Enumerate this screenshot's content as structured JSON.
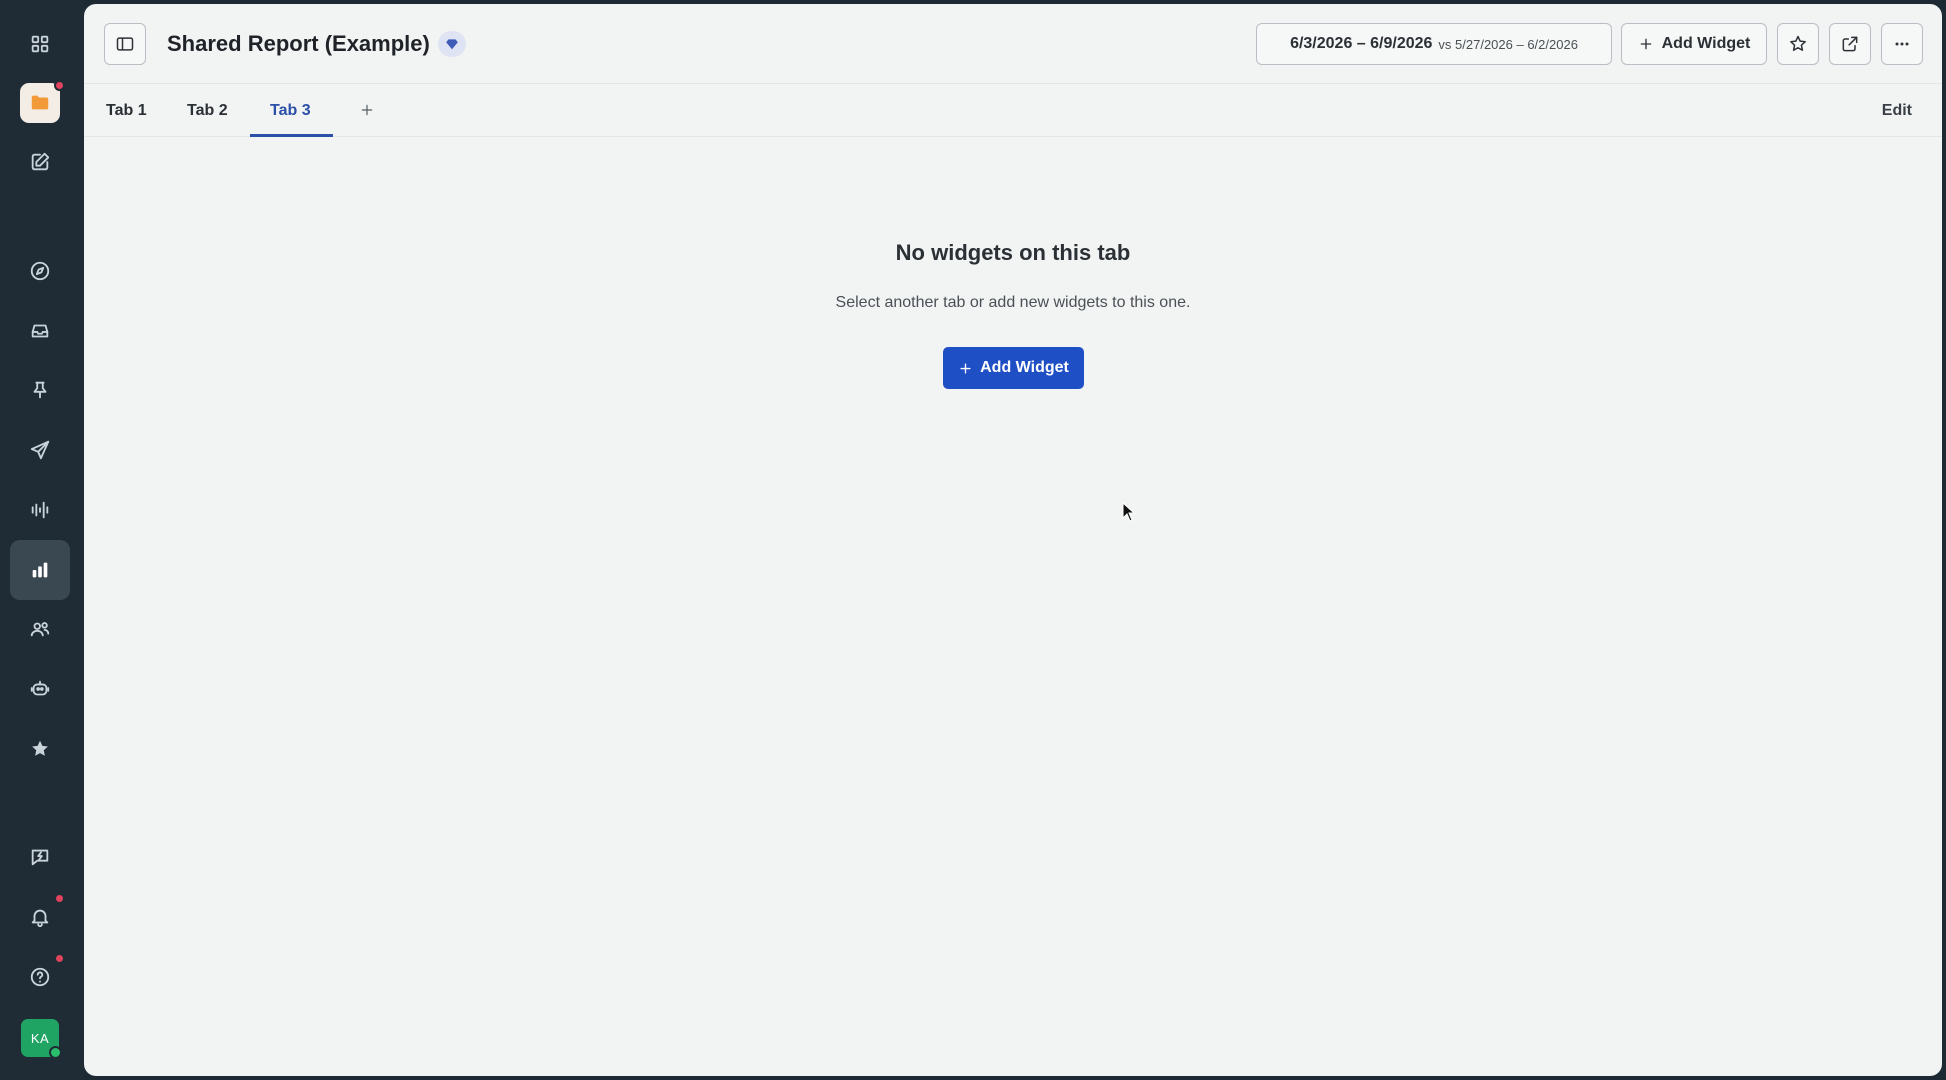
{
  "header": {
    "title": "Shared Report (Example)",
    "date_range": "6/3/2026 – 6/9/2026",
    "compare_label": "vs 5/27/2026 – 6/2/2026",
    "add_widget_label": "Add Widget"
  },
  "tabs": [
    {
      "label": "Tab 1"
    },
    {
      "label": "Tab 2"
    },
    {
      "label": "Tab 3",
      "active": true
    }
  ],
  "edit_label": "Edit",
  "empty_state": {
    "title": "No widgets on this tab",
    "subtitle": "Select another tab or add new widgets to this one.",
    "button_label": "Add Widget"
  },
  "user": {
    "initials": "KA"
  },
  "colors": {
    "accent": "#1e4fc4",
    "active_tab": "#2c4fa8",
    "sidebar": "#1f2c35",
    "notification": "#e0435c",
    "avatar": "#1fa463"
  },
  "icons": [
    "apps-grid-icon",
    "folder-icon",
    "compose-icon",
    "compass-icon",
    "inbox-icon",
    "pin-icon",
    "send-icon",
    "waveform-icon",
    "bar-chart-icon",
    "contacts-icon",
    "bot-icon",
    "star-badge-icon",
    "chat-bolt-icon",
    "bell-icon",
    "help-icon"
  ]
}
